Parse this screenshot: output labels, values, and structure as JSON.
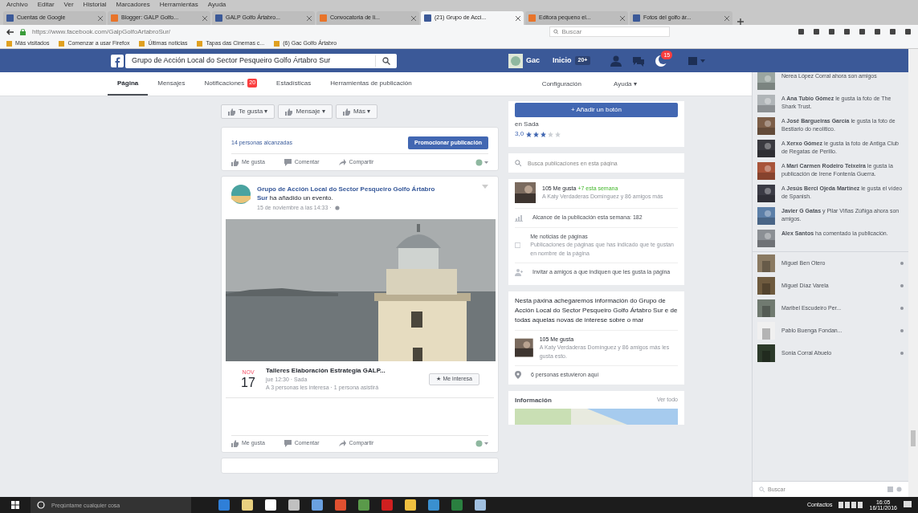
{
  "browser": {
    "menu": [
      "Archivo",
      "Editar",
      "Ver",
      "Historial",
      "Marcadores",
      "Herramientas",
      "Ayuda"
    ],
    "tabs": [
      {
        "label": "Cuentas de Google",
        "selected": false
      },
      {
        "label": "Blogger: GALP Golfo...",
        "selected": false
      },
      {
        "label": "GALP Golfo Ártabro...",
        "selected": false
      },
      {
        "label": "Convocatoria de li...",
        "selected": false
      },
      {
        "label": "(21) Grupo de Acci...",
        "selected": true
      },
      {
        "label": "Editora pequeno el...",
        "selected": false
      },
      {
        "label": "Fotos del golfo ár...",
        "selected": false
      }
    ],
    "url": "https://www.facebook.com/GalpGolfoArtabroSur/",
    "search_placeholder": "Buscar",
    "bookmarks": [
      "Más visitados",
      "Comenzar a usar Firefox",
      "Últimas noticias",
      "Tapas das Cinemas c...",
      "(6) Gac Golfo Ártabro"
    ]
  },
  "fb_header": {
    "search_value": "Grupo de Acción Local do Sector Pesqueiro Golfo Ártabro Sur",
    "user": "Gac",
    "home": "Inicio",
    "home_count": "20+",
    "notifications": "15"
  },
  "page_tabs": [
    {
      "label": "Página",
      "selected": true
    },
    {
      "label": "Mensajes",
      "selected": false
    },
    {
      "label": "Notificaciones",
      "selected": false,
      "badge": "20"
    },
    {
      "label": "Estadísticas",
      "selected": false
    },
    {
      "label": "Herramientas de publicación",
      "selected": false
    }
  ],
  "page_tabs_right": [
    "Configuración",
    "Ayuda ▾"
  ],
  "page_actions": [
    "Te gusta ▾",
    "Mensaje ▾",
    "Más ▾"
  ],
  "promo": {
    "reach": "14 personas alcanzadas",
    "button": "Promocionar publicación",
    "post_actions": [
      "Me gusta",
      "Comentar",
      "Compartir"
    ]
  },
  "post": {
    "author": "Grupo de Acción Local do Sector Pesqueiro Golfo Ártabro Sur",
    "action": "ha añadido un evento.",
    "time": "15 de noviembre a las 14:33 · ",
    "event": {
      "month": "NOV",
      "day": "17",
      "title": "Talleres Elaboración Estrategia GALP...",
      "when": "jue 12:30 · Sada",
      "meta": "A 3 personas les interesa · 1 persona asistirá",
      "button": "★ Me interesa"
    },
    "post_actions": [
      "Me gusta",
      "Comentar",
      "Compartir"
    ]
  },
  "right": {
    "add_button": "+ Añadir un botón",
    "category": "en Sada",
    "rating": "3,0",
    "stars": 3,
    "search_placeholder": "Busca publicaciones en esta página",
    "likes": "105 Me gusta",
    "likes_new": "+7 esta semana",
    "likes_friends": "A Katy Verdaderas Domínguez y 86 amigos más",
    "reach": "Alcance de la publicación esta semana: 182",
    "news_title": "Me noticias de páginas",
    "news_text": "Publicaciones de páginas que has indicado que te gustan en nombre de la página",
    "invite": "Invitar a amigos a que indiquen que les gusta la página",
    "about": "Nesta páxina achegaremos información do Grupo de Acción Local do Sector Pesqueiro Golfo Ártabro Sur e de todas aquelas novas de interese sobre o mar",
    "likes2": "105 Me gusta",
    "likes2_text": "A Katy Verdaderas Domínguez y 86 amigos más les gusta esto.",
    "checkins": "6 personas estuvieron aquí",
    "info_title": "Información",
    "info_link": "Ver todo"
  },
  "ticker": [
    {
      "text": "Nerea López Corral ahora son amigos"
    },
    {
      "text": "A **Ana Tubío Gómez** le gusta la foto de The Shark Trust."
    },
    {
      "text": "A **José Bargueiras García** le gusta la foto de Bestiario do neolítico."
    },
    {
      "text": "A **Xerxo Gómez** le gusta la foto de Antiga Club de Regatas de Perillo."
    },
    {
      "text": "A **Mari Carmen Rodeiro Teixeira** le gusta la publicación de Irene Fontenla Guerra."
    },
    {
      "text": "A **Jesús Berci Ojeda Martínez** le gusta el vídeo de Spanish."
    },
    {
      "text": "**Javier G Gatas** y Pilar Viñas Zúñiga ahora son amigos."
    },
    {
      "text": "**Alex Santos** ha comentado la publicación."
    }
  ],
  "chat": [
    {
      "name": "Miguel Ben Otero"
    },
    {
      "name": "Miguel Díaz Varela"
    },
    {
      "name": "Maribel Escudeiro Per..."
    },
    {
      "name": "Pablo Buenga Fondan..."
    },
    {
      "name": "Sonia Corral Abuelo"
    }
  ],
  "chat_search": {
    "placeholder": "Buscar"
  },
  "taskbar": {
    "search_placeholder": "Pregúntame cualquier cosa",
    "lang": "Contactos",
    "time": "16:05",
    "date": "16/11/2016"
  }
}
